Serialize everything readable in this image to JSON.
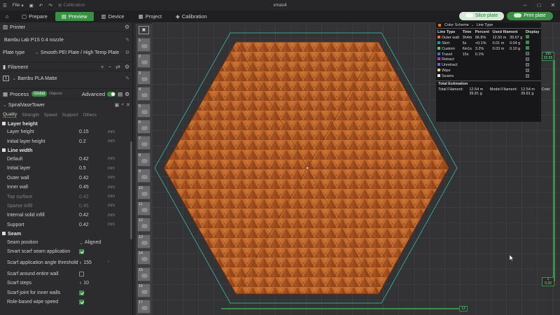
{
  "titlebar": {
    "file_label": "File",
    "calibration": "Calibration",
    "window_title": "xmas4"
  },
  "tabs": [
    {
      "label": "Prepare"
    },
    {
      "label": "Preview"
    },
    {
      "label": "Device"
    },
    {
      "label": "Project"
    },
    {
      "label": "Calibration"
    }
  ],
  "toolbar": {
    "slice_label": "Slice plate",
    "print_label": "Print plate"
  },
  "printer": {
    "section": "Printer",
    "name": "Bambu Lab P1S 0.4 nozzle",
    "plate_label": "Plate type",
    "plate_value": "Smooth PEI Plate / High Temp Plate"
  },
  "filament": {
    "section": "Filament",
    "index": "1",
    "name": "Bambu PLA Matte"
  },
  "process": {
    "section": "Process",
    "global": "Global",
    "objects": "Objects",
    "advanced": "Advanced",
    "preset": "SpiralVaseTower",
    "subtabs": [
      "Quality",
      "Strength",
      "Speed",
      "Support",
      "Others"
    ],
    "groups": [
      {
        "title": "Layer height",
        "rows": [
          {
            "label": "Layer height",
            "value": "0.15",
            "unit": "mm"
          },
          {
            "label": "Initial layer height",
            "value": "0.2",
            "unit": "mm"
          }
        ]
      },
      {
        "title": "Line width",
        "rows": [
          {
            "label": "Default",
            "value": "0.42",
            "unit": "mm"
          },
          {
            "label": "Initial layer",
            "value": "0.5",
            "unit": "mm"
          },
          {
            "label": "Outer wall",
            "value": "0.42",
            "unit": "mm"
          },
          {
            "label": "Inner wall",
            "value": "0.45",
            "unit": "mm"
          },
          {
            "label": "Top surface",
            "value": "0.42",
            "unit": "mm"
          },
          {
            "label": "Sparse infill",
            "value": "0.45",
            "unit": "mm"
          },
          {
            "label": "Internal solid infill",
            "value": "0.42",
            "unit": "mm"
          },
          {
            "label": "Support",
            "value": "0.42",
            "unit": "mm"
          }
        ]
      },
      {
        "title": "Seam",
        "rows": [
          {
            "label": "Seam position",
            "value": "Aligned"
          },
          {
            "label": "Smart scarf seam application",
            "value": ""
          },
          {
            "label": "Scarf application angle threshold",
            "value": "155",
            "unit": "°"
          },
          {
            "label": "Scarf around entire wall",
            "value": ""
          },
          {
            "label": "Scarf steps",
            "value": "10"
          },
          {
            "label": "Scarf joint for inner walls",
            "value": ""
          },
          {
            "label": "Role-based wipe speed",
            "value": ""
          }
        ]
      }
    ]
  },
  "layers": [
    "1",
    "2",
    "3",
    "4",
    "5",
    "6",
    "7",
    "8",
    "9",
    "10",
    "11",
    "12",
    "13",
    "14",
    "15",
    "16",
    "17"
  ],
  "color_scheme": {
    "title": "Color Scheme",
    "mode": "Line Type",
    "headers": [
      "Line Type",
      "Time",
      "Percent",
      "Used filament",
      "",
      "Display"
    ],
    "rows": [
      {
        "name": "Outer wall",
        "time": "3h4m",
        "percent": "96.8%",
        "length": "12.50 m",
        "weight": "39.67 g",
        "color": "#e8731c",
        "display": true
      },
      {
        "name": "Skirt",
        "time": "6s",
        "percent": "<0.1%",
        "length": "0.01 m",
        "weight": "0.04 g",
        "color": "#00a6a6",
        "display": true
      },
      {
        "name": "Custom",
        "time": "6m1s",
        "percent": "3.2%",
        "length": "0.03 m",
        "weight": "0.10 g",
        "color": "#5ec27b",
        "display": true
      },
      {
        "name": "Travel",
        "time": "15s",
        "percent": "0.1%",
        "length": "",
        "weight": "",
        "color": "#3d6fd4",
        "display": false
      },
      {
        "name": "Retract",
        "time": "",
        "percent": "",
        "length": "",
        "weight": "",
        "color": "#c42ec4",
        "display": false
      },
      {
        "name": "Unretract",
        "time": "",
        "percent": "",
        "length": "",
        "weight": "",
        "color": "#6a6af0",
        "display": false
      },
      {
        "name": "Wipe",
        "time": "",
        "percent": "",
        "length": "",
        "weight": "",
        "color": "#e8d28a",
        "display": false
      },
      {
        "name": "Seams",
        "time": "",
        "percent": "",
        "length": "",
        "weight": "",
        "color": "#e6e6e6",
        "display": false
      }
    ],
    "total_title": "Total Estimation",
    "totals": [
      {
        "k": "Total Filament:",
        "v": "12.54 m    39.81 g"
      },
      {
        "k": "Model Filament:",
        "v": "12.54 m    39.81 g"
      },
      {
        "k": "Cost:",
        "v": "0.99"
      },
      {
        "k": "Prepare time:",
        "v": "5m46s"
      },
      {
        "k": "Model printing time:",
        "v": "3h5m"
      },
      {
        "k": "Total time:",
        "v": "3h11m"
      }
    ]
  },
  "layer_slider": {
    "top_num": "150",
    "top_h": "22.55",
    "bot_num": "1",
    "bot_h": "0.20"
  },
  "move_slider": {
    "value": "12"
  },
  "colors": {
    "accent": "#3a8f47",
    "model": "#b4541f"
  }
}
